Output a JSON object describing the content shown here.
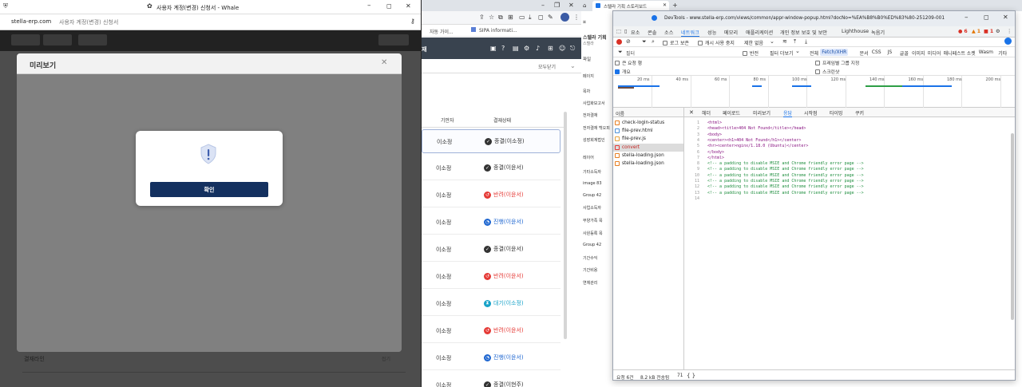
{
  "whale": {
    "title": "사용자 계정(변경) 신청서 - Whale",
    "url_host": "stella-erp.com",
    "url_rest": "사용자 계정(변경) 신청서",
    "preview_title": "미리보기",
    "alert_confirm": "확인",
    "bottom_label": "결재라인",
    "bottom_right": "접기"
  },
  "mid": {
    "bookmarks": [
      "자동 가이...",
      "SIPA informati..."
    ],
    "filter_right": "모두닫기",
    "col_drafter": "기안자",
    "col_status": "결재상태",
    "rows": [
      {
        "drafter": "이소정",
        "status": "종결(이소정)",
        "color": "#333333",
        "mark": "✓"
      },
      {
        "drafter": "이소정",
        "status": "종결(이윤서)",
        "color": "#333333",
        "mark": "✓"
      },
      {
        "drafter": "이소정",
        "status": "반려(이윤서)",
        "color": "#e53935",
        "mark": "↺"
      },
      {
        "drafter": "이소정",
        "status": "진행(이윤서)",
        "color": "#1e66d0",
        "mark": "◔"
      },
      {
        "drafter": "이소정",
        "status": "종결(이윤서)",
        "color": "#333333",
        "mark": "✓"
      },
      {
        "drafter": "이소정",
        "status": "반려(이윤서)",
        "color": "#e53935",
        "mark": "↺"
      },
      {
        "drafter": "이소정",
        "status": "대기(이소정)",
        "color": "#17a2c8",
        "mark": "⧗"
      },
      {
        "drafter": "이소정",
        "status": "반려(이윤서)",
        "color": "#e53935",
        "mark": "↺"
      },
      {
        "drafter": "이소정",
        "status": "진행(이윤서)",
        "color": "#1e66d0",
        "mark": "◔"
      },
      {
        "drafter": "이소정",
        "status": "종결(이현주)",
        "color": "#333333",
        "mark": "✓"
      }
    ]
  },
  "right": {
    "tab_title": "스텔라 기획 스토리보드",
    "side_title": "스텔라 기획",
    "side_sub": "스텔라",
    "side_items": [
      "페이지",
      "목차",
      "사업화보고서",
      "전자결재",
      "전자결재 백오피",
      "성장회계법인",
      "레이어",
      "기타소득자",
      "image 83",
      "Group 42",
      "사업소득자",
      "부양가족 목",
      "사원등록 목",
      "Group 42",
      "기간수익",
      "기간비용",
      "연체관리"
    ]
  },
  "devtools": {
    "title": "DevTools - www.stella-erp.com/views/common/appr-window-popup.html?docNo=%EA%B8%B0%ED%83%80-251209-001",
    "tabs": [
      "요소",
      "콘솔",
      "소스",
      "네트워크",
      "성능",
      "메모리",
      "애플리케이션",
      "개인 정보 보호 및 보안",
      "Lighthouse",
      "녹음기"
    ],
    "active_tab": "네트워크",
    "counts": {
      "errors": "6",
      "warnings": "1",
      "info": "1"
    },
    "toolbar": {
      "preserve_log": "로그 보존",
      "disable_cache": "캐시 사용 중지",
      "throttle": "제한 없음"
    },
    "filter": {
      "placeholder": "필터",
      "invert": "반전",
      "more_filters": "필터 더보기",
      "types": [
        "전체",
        "Fetch/XHR",
        "문서",
        "CSS",
        "JS",
        "글꼴",
        "이미지",
        "미디어",
        "매니페스트",
        "소켓",
        "Wasm",
        "기타"
      ]
    },
    "checks": {
      "big_rows": "큰 요청 행",
      "overview": "개요",
      "group_by_frame": "프레임별 그룹 지정",
      "screenshots": "스크린샷"
    },
    "timeline_ticks": [
      "20 ms",
      "40 ms",
      "60 ms",
      "80 ms",
      "100 ms",
      "120 ms",
      "140 ms",
      "160 ms",
      "180 ms",
      "200 ms"
    ],
    "names_header": "이름",
    "requests": [
      {
        "name": "check-login-status",
        "icon": "#e67e22"
      },
      {
        "name": "file-prev.html",
        "icon": "#4a90d9"
      },
      {
        "name": "file-prev.js",
        "icon": "#e6a23c"
      },
      {
        "name": "convert",
        "icon": "#e53935"
      },
      {
        "name": "stella-loading.json",
        "icon": "#e67e22"
      },
      {
        "name": "stella-loading.json",
        "icon": "#e67e22"
      }
    ],
    "detail_tabs": [
      "헤더",
      "페이로드",
      "미리보기",
      "응답",
      "시작점",
      "타이밍",
      "쿠키"
    ],
    "active_detail_tab": "응답",
    "code": [
      "<html>",
      "<head><title>404 Not Found</title></head>",
      "<body>",
      "<center><h1>404 Not Found</h1></center>",
      "<hr><center>nginx/1.18.0 (Ubuntu)</center>",
      "</body>",
      "</html>",
      "<!-- a padding to disable MSIE and Chrome friendly error page -->",
      "<!-- a padding to disable MSIE and Chrome friendly error page -->",
      "<!-- a padding to disable MSIE and Chrome friendly error page -->",
      "<!-- a padding to disable MSIE and Chrome friendly error page -->",
      "<!-- a padding to disable MSIE and Chrome friendly error page -->",
      "<!-- a padding to disable MSIE and Chrome friendly error page -->",
      ""
    ],
    "status": {
      "requests": "요청 6건",
      "transferred": "8.2 kB 전송됨",
      "lines": "71"
    }
  }
}
